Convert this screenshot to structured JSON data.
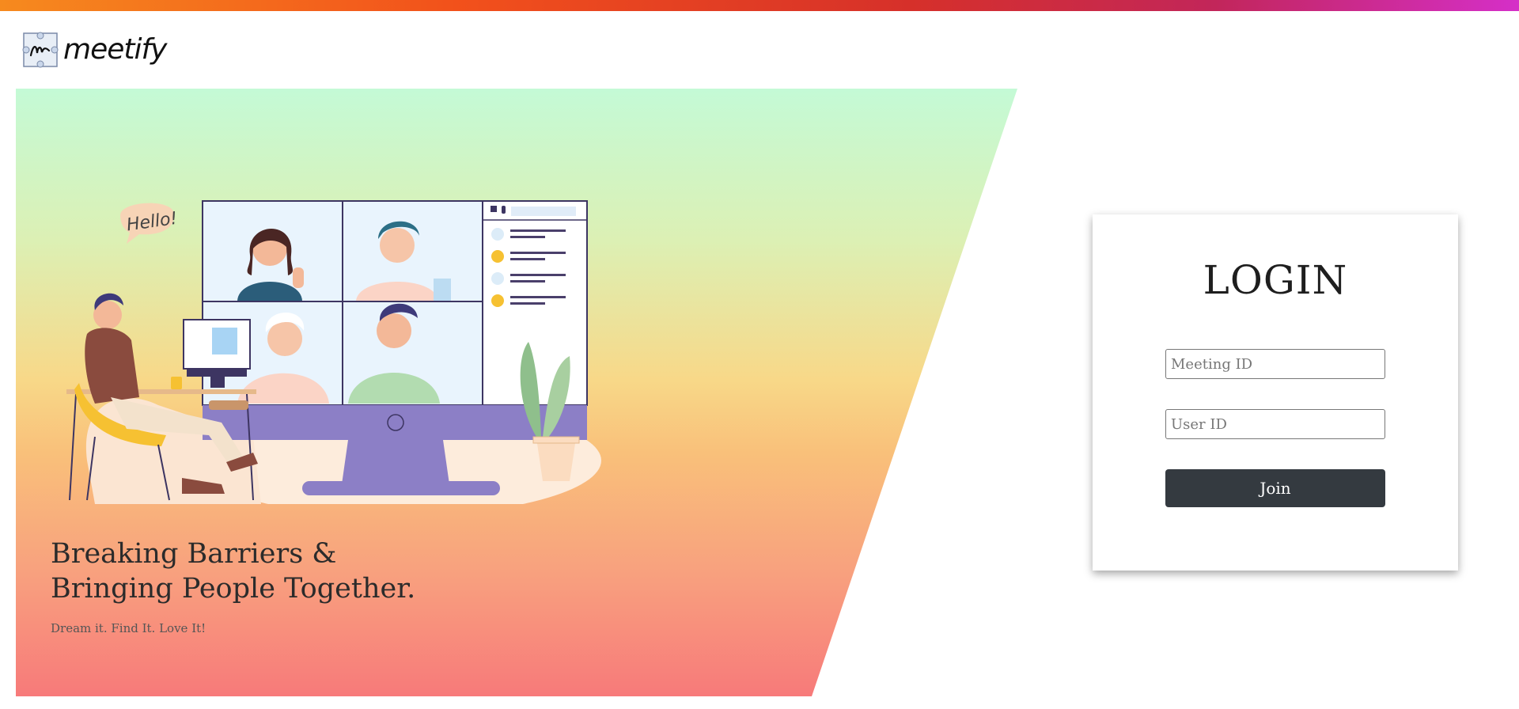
{
  "brand": {
    "name": "meetify",
    "icon": "meetify-logo-icon"
  },
  "hero": {
    "headline": "Breaking Barriers & Bringing People Together.",
    "tagline": "Dream it. Find It. Love It!",
    "speech_bubble": "Hello!",
    "gradient_colors": [
      "#c4fad6",
      "#f8d888",
      "#f77a7a"
    ]
  },
  "login": {
    "title": "LOGIN",
    "meeting_id_placeholder": "Meeting ID",
    "meeting_id_value": "",
    "user_id_placeholder": "User ID",
    "user_id_value": "",
    "join_label": "Join"
  },
  "colors": {
    "accent_bar": [
      "#f68a1e",
      "#d6302a",
      "#d52fc8"
    ],
    "button": "#343a40",
    "monitor": "#8c7fc6"
  }
}
